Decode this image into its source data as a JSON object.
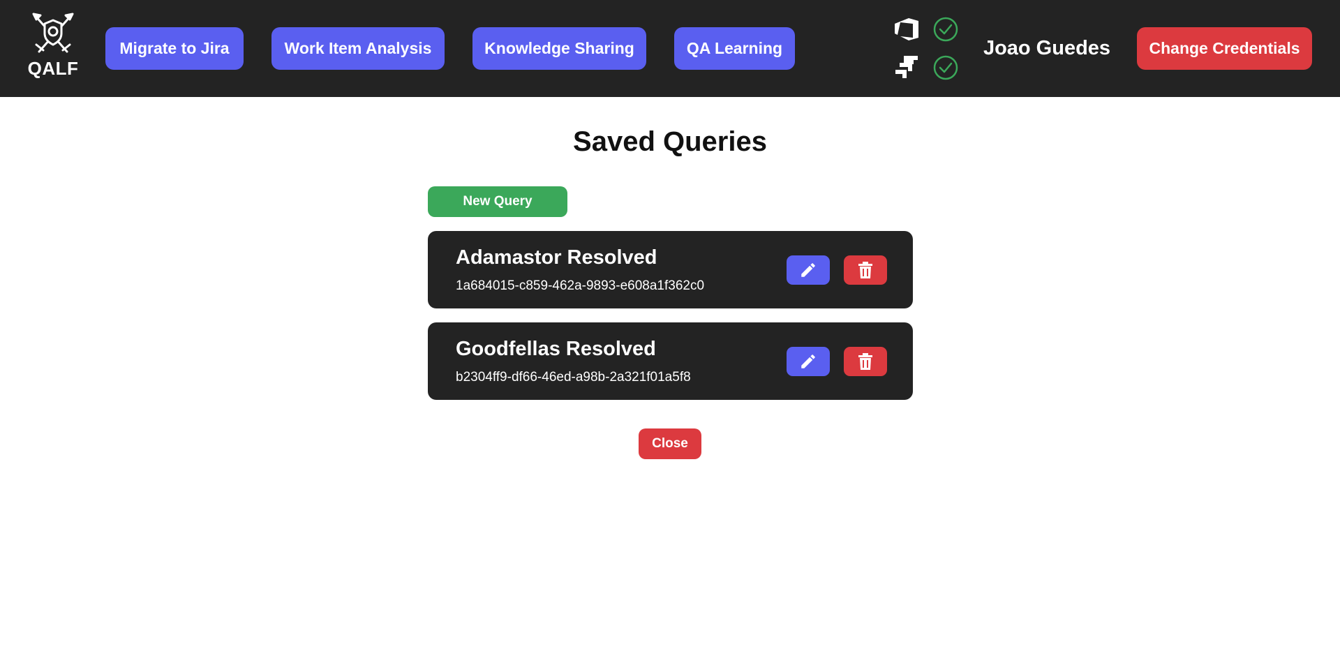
{
  "app": {
    "logo_text": "QALF",
    "logo_icon": "shield-swords-icon"
  },
  "nav": {
    "items": [
      {
        "label": "Migrate to Jira"
      },
      {
        "label": "Work Item Analysis"
      },
      {
        "label": "Knowledge Sharing"
      },
      {
        "label": "QA Learning"
      }
    ]
  },
  "connections": [
    {
      "icon": "azure-devops-icon",
      "status_icon": "check-circle-icon",
      "status": "connected"
    },
    {
      "icon": "jira-icon",
      "status_icon": "check-circle-icon",
      "status": "connected"
    }
  ],
  "user": {
    "name": "Joao Guedes",
    "change_credentials_label": "Change Credentials"
  },
  "main": {
    "title": "Saved Queries",
    "new_query_label": "New Query",
    "queries": [
      {
        "name": "Adamastor Resolved",
        "id": "1a684015-c859-462a-9893-e608a1f362c0",
        "edit_icon": "pencil-icon",
        "delete_icon": "trash-icon"
      },
      {
        "name": "Goodfellas Resolved",
        "id": "b2304ff9-df66-46ed-a98b-2a321f01a5f8",
        "edit_icon": "pencil-icon",
        "delete_icon": "trash-icon"
      }
    ],
    "close_label": "Close"
  },
  "colors": {
    "header_bg": "#232323",
    "primary": "#5a5ff0",
    "danger": "#dc3a3f",
    "success": "#3ba85a",
    "card_bg": "#232323"
  }
}
